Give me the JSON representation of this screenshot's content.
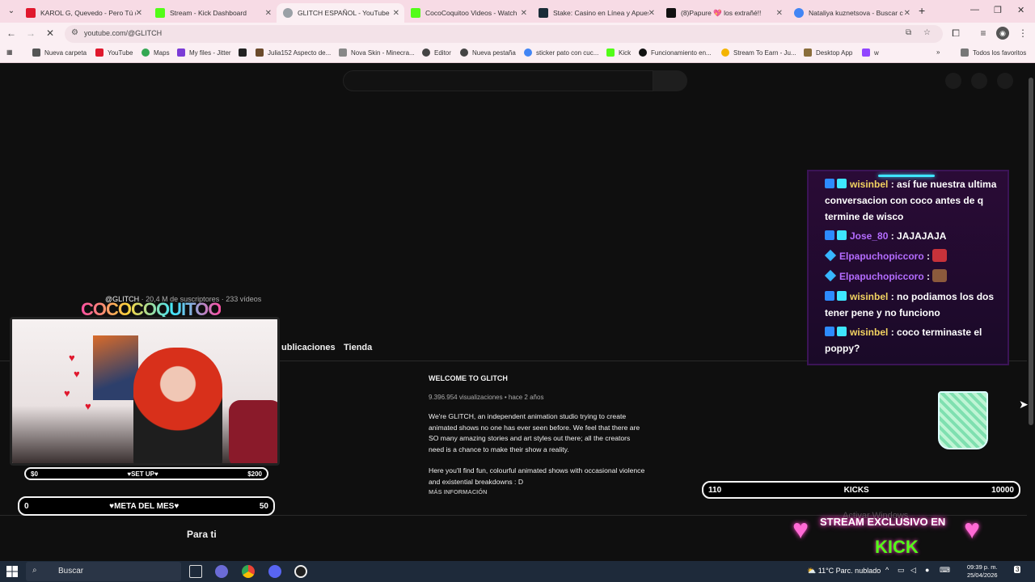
{
  "browser": {
    "tabs": [
      {
        "title": "KAROL G, Quevedo - Pero Tú (O",
        "favicon_color": "#e0182d",
        "active": false
      },
      {
        "title": "Stream - Kick Dashboard",
        "favicon_color": "#53fc18",
        "active": false
      },
      {
        "title": "GLITCH ESPAÑOL - YouTube",
        "favicon_color": "#9aa0a6",
        "active": true
      },
      {
        "title": "CocoCoquitoo Videos - Watch",
        "favicon_color": "#53fc18",
        "active": false
      },
      {
        "title": "Stake: Casino en Línea y Apues",
        "favicon_color": "#1a2c38",
        "active": false
      },
      {
        "title": "(8)Papure 💖 los extrañé!!",
        "favicon_color": "#111111",
        "active": false
      },
      {
        "title": "Nataliya kuznetsova - Buscar c",
        "favicon_color": "#4285f4",
        "active": false
      }
    ],
    "url": "youtube.com/@GLITCH",
    "bookmarks": [
      {
        "label": "Nueva carpeta",
        "icon": "folder-icon"
      },
      {
        "label": "YouTube",
        "icon": "youtube-icon"
      },
      {
        "label": "Maps",
        "icon": "maps-icon"
      },
      {
        "label": "My files - Jitter",
        "icon": "jitter-icon"
      },
      {
        "label": "",
        "icon": "s-icon"
      },
      {
        "label": "Julia152 Aspecto de...",
        "icon": "minecraft-icon"
      },
      {
        "label": "Nova Skin - Minecra...",
        "icon": "novaskin-icon"
      },
      {
        "label": "Editor",
        "icon": "editor-icon"
      },
      {
        "label": "Nueva pestaña",
        "icon": "chrome-icon"
      },
      {
        "label": "sticker pato con cuc...",
        "icon": "google-icon"
      },
      {
        "label": "Kick",
        "icon": "kick-icon"
      },
      {
        "label": "Funcionamiento en...",
        "icon": "github-icon"
      },
      {
        "label": "Stream To Earn - Ju...",
        "icon": "streamtoearn-icon"
      },
      {
        "label": "Desktop App",
        "icon": "desktop-icon"
      },
      {
        "label": "w",
        "icon": "twitch-icon"
      }
    ],
    "all_bookmarks": "Todos los favoritos"
  },
  "youtube": {
    "handle": "@GLITCH",
    "meta": "· 20,4 M de suscriptores · 233 vídeos",
    "tabs": [
      "ublicaciones",
      "Tienda"
    ],
    "welcome_title": "WELCOME TO GLITCH",
    "welcome_stats": "9.396.954 visualizaciones • hace 2 años",
    "welcome_desc": "We're GLITCH, an independent animation studio trying to create animated shows no one has ever seen before. We feel that there are SO many amazing stories and art styles out there; all the creators need is a chance to make their show a reality.",
    "welcome_desc2": "Here you'll find fun, colourful animated shows with occasional violence and existential breakdowns : D",
    "more_info": "MÁS INFORMACIÓN",
    "section": "Para ti"
  },
  "overlay": {
    "streamer_logo": "COCOCOQUITOO",
    "setup_bar": {
      "left": "$0",
      "center": "♥SET UP♥",
      "right": "$200",
      "progress": 0
    },
    "goal_bar": {
      "left": "0",
      "center": "♥META DEL MES♥",
      "right": "50",
      "progress": 0
    },
    "kicks_bar": {
      "left": "110",
      "center": "KICKS",
      "right": "10000",
      "progress": 0.011
    },
    "chat": [
      {
        "user": "wisinbel",
        "user_color": "#f3d361",
        "text": ": así fue nuestra ultima conversacion con coco antes de q termine de wisco"
      },
      {
        "user": "Jose_80",
        "user_color": "#b46cff",
        "text": ": JAJAJAJA"
      },
      {
        "user": "Elpapuchopiccoro",
        "user_color": "#b46cff",
        "text": ":"
      },
      {
        "user": "Elpapuchopiccoro",
        "user_color": "#b46cff",
        "text": ":"
      },
      {
        "user": "wisinbel",
        "user_color": "#f3d361",
        "text": ": no podiamos los dos tener pene y no funciono"
      },
      {
        "user": "wisinbel",
        "user_color": "#f3d361",
        "text": ": coco terminaste el poppy?"
      }
    ],
    "kick_banner_line1": "STREAM EXCLUSIVO EN",
    "kick_banner_line2": "KICK",
    "activate_windows": "Activar Windows"
  },
  "taskbar": {
    "search_placeholder": "Buscar",
    "weather": "11°C  Parc. nublado",
    "time": "09:39 p. m.",
    "date": "25/04/2026"
  }
}
